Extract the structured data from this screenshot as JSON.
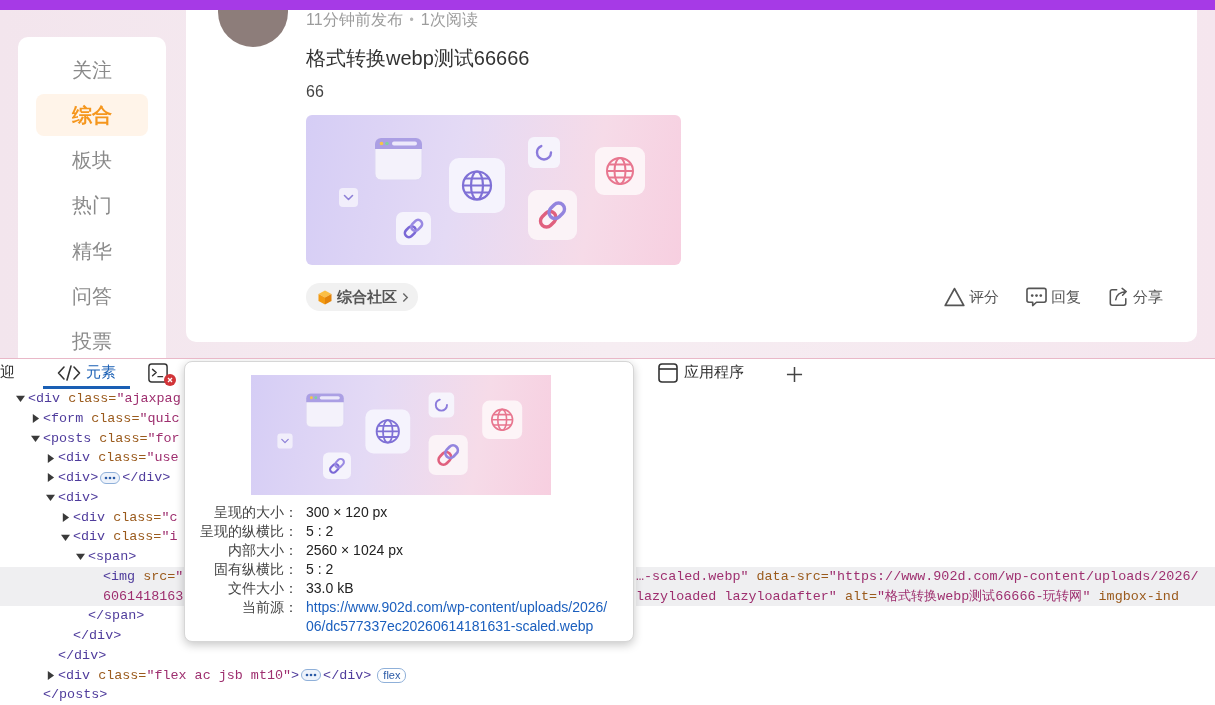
{
  "sidebar": {
    "items": [
      {
        "label": "关注",
        "selected": false
      },
      {
        "label": "综合",
        "selected": true
      },
      {
        "label": "板块",
        "selected": false
      },
      {
        "label": "热门",
        "selected": false
      },
      {
        "label": "精华",
        "selected": false
      },
      {
        "label": "问答",
        "selected": false
      },
      {
        "label": "投票",
        "selected": false
      }
    ]
  },
  "post": {
    "time": "11分钟前发布",
    "separator": "•",
    "views": "1次阅读",
    "title": "格式转换webp测试66666",
    "excerpt": "66",
    "category": "综合社区",
    "actions": [
      {
        "kind": "rate",
        "label": "评分"
      },
      {
        "kind": "reply",
        "label": "回复"
      },
      {
        "kind": "share",
        "label": "分享"
      }
    ]
  },
  "devtools": {
    "tabs": [
      {
        "kind": "plain",
        "label": "迎",
        "selected": false
      },
      {
        "kind": "elements",
        "label": "元素",
        "selected": true
      },
      {
        "kind": "console",
        "selected": false,
        "error_badge": true
      },
      {
        "kind": "application",
        "label": "应用程序",
        "selected": false
      }
    ],
    "dom_tree": [
      {
        "rows": [
          {
            "left": [
              {
                "kind": "tag",
                "text": "<div"
              },
              {
                "kind": "attr",
                "text": " class="
              },
              {
                "kind": "value",
                "text": "\"ajaxpag"
              }
            ]
          }
        ],
        "expanded": true,
        "selected": false,
        "children": [
          {
            "rows": [
              {
                "left": [
                  {
                    "kind": "tag",
                    "text": "<form"
                  },
                  {
                    "kind": "attr",
                    "text": " class="
                  },
                  {
                    "kind": "value",
                    "text": "\"quic"
                  }
                ]
              }
            ],
            "expanded": false,
            "selected": false
          },
          {
            "rows": [
              {
                "left": [
                  {
                    "kind": "tag",
                    "text": "<posts"
                  },
                  {
                    "kind": "attr",
                    "text": " class="
                  },
                  {
                    "kind": "value",
                    "text": "\"for"
                  }
                ]
              }
            ],
            "expanded": true,
            "selected": false,
            "children": [
              {
                "rows": [
                  {
                    "left": [
                      {
                        "kind": "tag",
                        "text": "<div"
                      },
                      {
                        "kind": "attr",
                        "text": " class="
                      },
                      {
                        "kind": "value",
                        "text": "\"use"
                      }
                    ]
                  }
                ],
                "expanded": false,
                "selected": false
              },
              {
                "rows": [
                  {
                    "left": [
                      {
                        "kind": "tag",
                        "text": "<div>"
                      },
                      {
                        "kind": "more"
                      },
                      {
                        "kind": "tag",
                        "text": "</div>"
                      }
                    ]
                  }
                ],
                "expanded": false,
                "selected": false
              },
              {
                "rows": [
                  {
                    "left": [
                      {
                        "kind": "tag",
                        "text": "<div>"
                      }
                    ]
                  }
                ],
                "expanded": true,
                "selected": false,
                "children": [
                  {
                    "rows": [
                      {
                        "left": [
                          {
                            "kind": "tag",
                            "text": "<div"
                          },
                          {
                            "kind": "attr",
                            "text": " class="
                          },
                          {
                            "kind": "value",
                            "text": "\"c"
                          }
                        ]
                      }
                    ],
                    "expanded": false,
                    "selected": false
                  },
                  {
                    "rows": [
                      {
                        "left": [
                          {
                            "kind": "tag",
                            "text": "<div"
                          },
                          {
                            "kind": "attr",
                            "text": " class="
                          },
                          {
                            "kind": "value",
                            "text": "\"i"
                          }
                        ]
                      }
                    ],
                    "expanded": true,
                    "selected": false,
                    "children": [
                      {
                        "rows": [
                          {
                            "left": [
                              {
                                "kind": "tag",
                                "text": "<span>"
                              }
                            ]
                          }
                        ],
                        "expanded": true,
                        "selected": false,
                        "children": [
                          {
                            "rows": [
                              {
                                "left": [
                                  {
                                    "kind": "tag",
                                    "text": "<img"
                                  },
                                  {
                                    "kind": "attr",
                                    "text": " src="
                                  },
                                  {
                                    "kind": "value",
                                    "text": "\""
                                  }
                                ],
                                "right": [
                                  {
                                    "kind": "value",
                                    "text": "…-scaled.webp\""
                                  },
                                  {
                                    "kind": "attr",
                                    "text": " data-src="
                                  },
                                  {
                                    "kind": "value",
                                    "text": "\"https://www.902d.com/wp-content/uploads/2026/"
                                  }
                                ]
                              },
                              {
                                "left": [
                                  {
                                    "kind": "value",
                                    "text": "6061418163"
                                  }
                                ],
                                "right": [
                                  {
                                    "kind": "value",
                                    "text": "lazyloaded lazyloadafter\""
                                  },
                                  {
                                    "kind": "attr",
                                    "text": " alt="
                                  },
                                  {
                                    "kind": "value",
                                    "text": "\"格式转换webp测试66666-玩转网\""
                                  },
                                  {
                                    "kind": "attr",
                                    "text": " imgbox-ind"
                                  }
                                ]
                              }
                            ],
                            "selected": true
                          }
                        ],
                        "close": [
                          {
                            "kind": "tag",
                            "text": "</span>"
                          }
                        ]
                      }
                    ],
                    "close": [
                      {
                        "kind": "tag",
                        "text": "</div>"
                      }
                    ]
                  }
                ],
                "close": [
                  {
                    "kind": "tag",
                    "text": "</div>"
                  }
                ]
              },
              {
                "rows": [
                  {
                    "left": [
                      {
                        "kind": "tag",
                        "text": "<div"
                      },
                      {
                        "kind": "attr",
                        "text": " class="
                      },
                      {
                        "kind": "value",
                        "text": "\"flex ac jsb mt10\""
                      },
                      {
                        "kind": "tag",
                        "text": ">"
                      },
                      {
                        "kind": "more"
                      },
                      {
                        "kind": "tag",
                        "text": "</div>"
                      },
                      {
                        "kind": "badge",
                        "text": "flex"
                      }
                    ]
                  }
                ],
                "expanded": false,
                "selected": false
              }
            ],
            "close": [
              {
                "kind": "tag",
                "text": "</posts>"
              }
            ]
          }
        ]
      }
    ],
    "tooltip": {
      "rows": [
        {
          "kind": "text",
          "label": "呈现的大小：",
          "value": "300 × 120 px"
        },
        {
          "kind": "text",
          "label": "呈现的纵横比：",
          "value": "5 : 2"
        },
        {
          "kind": "text",
          "label": "内部大小：",
          "value": "2560 × 1024 px"
        },
        {
          "kind": "text",
          "label": "固有纵横比：",
          "value": "5 : 2"
        },
        {
          "kind": "text",
          "label": "文件大小：",
          "value": "33.0 kB"
        },
        {
          "kind": "link",
          "label": "当前源：",
          "value": "https://www.902d.com/wp-content/uploads/2026/06/dc577337ec20260614181631-scaled.webp"
        }
      ]
    }
  }
}
